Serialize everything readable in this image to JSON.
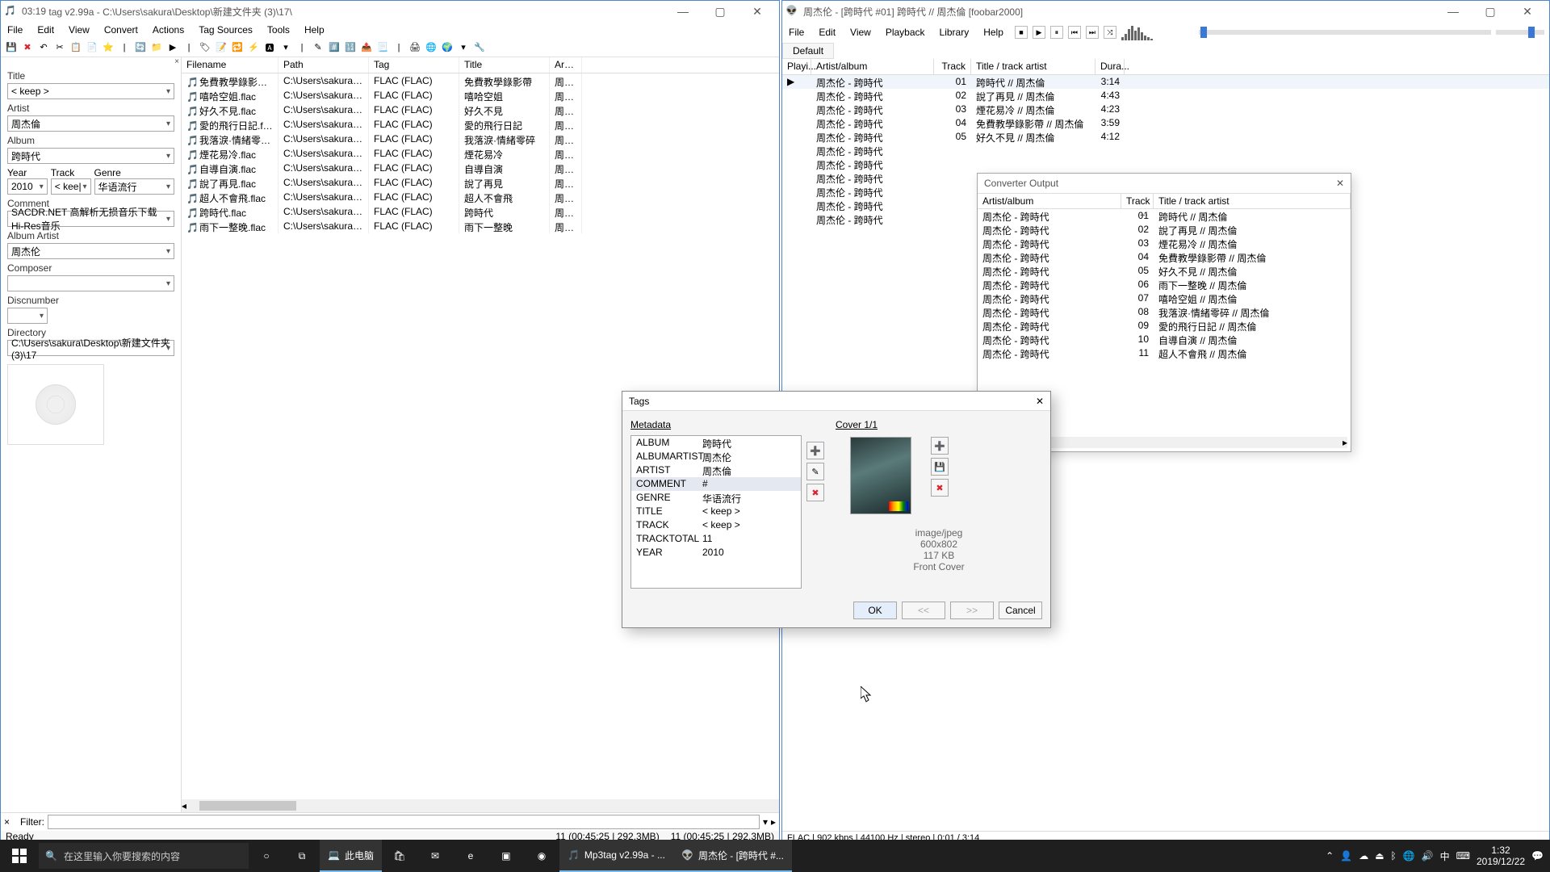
{
  "mp3tag": {
    "title_prefix": "03:19",
    "title": "tag v2.99a  -  C:\\Users\\sakura\\Desktop\\新建文件夹 (3)\\17\\",
    "menus": [
      "File",
      "Edit",
      "View",
      "Convert",
      "Actions",
      "Tag Sources",
      "Tools",
      "Help"
    ],
    "panel": {
      "title_label": "Title",
      "title_value": "< keep >",
      "artist_label": "Artist",
      "artist_value": "周杰倫",
      "album_label": "Album",
      "album_value": "跨時代",
      "year_label": "Year",
      "year_value": "2010",
      "track_label": "Track",
      "track_value": "< kee|",
      "genre_label": "Genre",
      "genre_value": "华语流行",
      "comment_label": "Comment",
      "comment_value": "SACDR.NET 高解析无损音乐下载 Hi-Res音乐",
      "albumartist_label": "Album Artist",
      "albumartist_value": "周杰伦",
      "composer_label": "Composer",
      "composer_value": "",
      "disc_label": "Discnumber",
      "disc_value": "",
      "dir_label": "Directory",
      "dir_value": "C:\\Users\\sakura\\Desktop\\新建文件夹 (3)\\17"
    },
    "columns": {
      "filename": "Filename",
      "path": "Path",
      "tag": "Tag",
      "title": "Title",
      "artist": "Artist"
    },
    "files": [
      {
        "fn": "免費教學錄影帶.flac",
        "path": "C:\\Users\\sakura\\Desk...",
        "tag": "FLAC (FLAC)",
        "title": "免費教學錄影帶",
        "artist": "周杰..."
      },
      {
        "fn": "嘻哈空姐.flac",
        "path": "C:\\Users\\sakura\\Desk...",
        "tag": "FLAC (FLAC)",
        "title": "嘻哈空姐",
        "artist": "周杰..."
      },
      {
        "fn": "好久不見.flac",
        "path": "C:\\Users\\sakura\\Desk...",
        "tag": "FLAC (FLAC)",
        "title": "好久不見",
        "artist": "周杰..."
      },
      {
        "fn": "愛的飛行日記.flac",
        "path": "C:\\Users\\sakura\\Desk...",
        "tag": "FLAC (FLAC)",
        "title": "愛的飛行日記",
        "artist": "周杰..."
      },
      {
        "fn": "我落淚·情緒零碎.flac",
        "path": "C:\\Users\\sakura\\Desk...",
        "tag": "FLAC (FLAC)",
        "title": "我落淚·情緒零碎",
        "artist": "周杰..."
      },
      {
        "fn": "煙花易冷.flac",
        "path": "C:\\Users\\sakura\\Desk...",
        "tag": "FLAC (FLAC)",
        "title": "煙花易冷",
        "artist": "周杰..."
      },
      {
        "fn": "自導自演.flac",
        "path": "C:\\Users\\sakura\\Desk...",
        "tag": "FLAC (FLAC)",
        "title": "自導自演",
        "artist": "周杰..."
      },
      {
        "fn": "說了再見.flac",
        "path": "C:\\Users\\sakura\\Desk...",
        "tag": "FLAC (FLAC)",
        "title": "說了再見",
        "artist": "周杰..."
      },
      {
        "fn": "超人不會飛.flac",
        "path": "C:\\Users\\sakura\\Desk...",
        "tag": "FLAC (FLAC)",
        "title": "超人不會飛",
        "artist": "周杰..."
      },
      {
        "fn": "跨時代.flac",
        "path": "C:\\Users\\sakura\\Desk...",
        "tag": "FLAC (FLAC)",
        "title": "跨時代",
        "artist": "周杰..."
      },
      {
        "fn": "雨下一整晚.flac",
        "path": "C:\\Users\\sakura\\Desk...",
        "tag": "FLAC (FLAC)",
        "title": "雨下一整晚",
        "artist": "周杰..."
      }
    ],
    "filter_label": "Filter:",
    "status_left": "Ready",
    "status_mid": "11 (00:45:25 | 292.3MB)",
    "status_right": "11 (00:45:25 | 292.3MB)"
  },
  "foobar": {
    "title": "周杰伦 - [跨時代 #01] 跨時代 // 周杰倫   [foobar2000]",
    "menus": [
      "File",
      "Edit",
      "View",
      "Playback",
      "Library",
      "Help"
    ],
    "tab": "Default",
    "cols": {
      "p": "Playi...",
      "aa": "Artist/album",
      "tn": "Track ...",
      "tt": "Title / track artist",
      "d": "Dura..."
    },
    "rows": [
      {
        "np": true,
        "aa": "周杰伦 - 跨時代",
        "tn": "01",
        "tt": "跨時代 // 周杰倫",
        "d": "3:14"
      },
      {
        "aa": "周杰伦 - 跨時代",
        "tn": "02",
        "tt": "說了再見 // 周杰倫",
        "d": "4:43"
      },
      {
        "aa": "周杰伦 - 跨時代",
        "tn": "03",
        "tt": "煙花易冷 // 周杰倫",
        "d": "4:23"
      },
      {
        "aa": "周杰伦 - 跨時代",
        "tn": "04",
        "tt": "免費教學錄影帶 // 周杰倫",
        "d": "3:59"
      },
      {
        "aa": "周杰伦 - 跨時代",
        "tn": "05",
        "tt": "好久不見 // 周杰倫",
        "d": "4:12"
      },
      {
        "aa": "周杰伦 - 跨時代"
      },
      {
        "aa": "周杰伦 - 跨時代"
      },
      {
        "aa": "周杰伦 - 跨時代"
      },
      {
        "aa": "周杰伦 - 跨時代"
      },
      {
        "aa": "周杰伦 - 跨時代"
      },
      {
        "aa": "周杰伦 - 跨時代"
      }
    ],
    "status": "FLAC | 902 kbps | 44100 Hz | stereo | 0:01 / 3:14"
  },
  "converter": {
    "title": "Converter Output",
    "cols": {
      "aa": "Artist/album",
      "tn": "Track ...",
      "tt": "Title / track artist"
    },
    "rows": [
      {
        "aa": "周杰伦 - 跨時代",
        "tn": "01",
        "tt": "跨時代 // 周杰倫"
      },
      {
        "aa": "周杰伦 - 跨時代",
        "tn": "02",
        "tt": "說了再見 // 周杰倫"
      },
      {
        "aa": "周杰伦 - 跨時代",
        "tn": "03",
        "tt": "煙花易冷 // 周杰倫"
      },
      {
        "aa": "周杰伦 - 跨時代",
        "tn": "04",
        "tt": "免費教學錄影帶 // 周杰倫"
      },
      {
        "aa": "周杰伦 - 跨時代",
        "tn": "05",
        "tt": "好久不見 // 周杰倫"
      },
      {
        "aa": "周杰伦 - 跨時代",
        "tn": "06",
        "tt": "雨下一整晚 // 周杰倫"
      },
      {
        "aa": "周杰伦 - 跨時代",
        "tn": "07",
        "tt": "嘻哈空姐 // 周杰倫"
      },
      {
        "aa": "周杰伦 - 跨時代",
        "tn": "08",
        "tt": "我落淚·情緒零碎 // 周杰倫"
      },
      {
        "aa": "周杰伦 - 跨時代",
        "tn": "09",
        "tt": "愛的飛行日記 // 周杰倫"
      },
      {
        "aa": "周杰伦 - 跨時代",
        "tn": "10",
        "tt": "自導自演 // 周杰倫"
      },
      {
        "aa": "周杰伦 - 跨時代",
        "tn": "11",
        "tt": "超人不會飛 // 周杰倫"
      }
    ]
  },
  "tags": {
    "title": "Tags",
    "meta_label": "Metadata",
    "cover_label": "Cover 1/1",
    "rows": [
      {
        "k": "ALBUM",
        "v": "跨時代"
      },
      {
        "k": "ALBUMARTIST",
        "v": "周杰伦"
      },
      {
        "k": "ARTIST",
        "v": "周杰倫"
      },
      {
        "k": "COMMENT",
        "v": "#",
        "sel": true
      },
      {
        "k": "GENRE",
        "v": "华语流行"
      },
      {
        "k": "TITLE",
        "v": "< keep >"
      },
      {
        "k": "TRACK",
        "v": "< keep >"
      },
      {
        "k": "TRACKTOTAL",
        "v": "11"
      },
      {
        "k": "YEAR",
        "v": "2010"
      }
    ],
    "cover_meta": {
      "mime": "image/jpeg",
      "dim": "600x802",
      "size": "117 KB",
      "type": "Front Cover"
    },
    "buttons": {
      "ok": "OK",
      "prev": "<<",
      "next": ">>",
      "cancel": "Cancel"
    }
  },
  "taskbar": {
    "search_placeholder": "在这里输入你要搜索的内容",
    "explorer": "此电脑",
    "app1": "Mp3tag v2.99a - ...",
    "app2": "周杰伦 - [跨時代 #...",
    "time": "1:32",
    "date": "2019/12/22",
    "ime": "中"
  }
}
